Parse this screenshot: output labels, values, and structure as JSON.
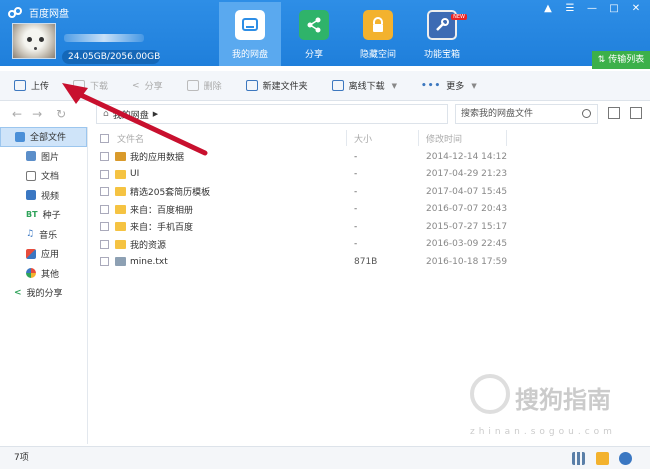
{
  "app": {
    "title": "百度网盘",
    "quota": "24.05GB/2056.00GB"
  },
  "nav": [
    {
      "label": "我的网盘"
    },
    {
      "label": "分享"
    },
    {
      "label": "隐藏空间"
    },
    {
      "label": "功能宝箱",
      "badge": "NEW"
    }
  ],
  "transfer_label": "传输列表",
  "toolbar": {
    "upload": "上传",
    "download": "下载",
    "share": "分享",
    "delete": "删除",
    "new_folder": "新建文件夹",
    "offline": "离线下载",
    "more": "更多"
  },
  "breadcrumb": {
    "root": "我的网盘"
  },
  "search": {
    "placeholder": "搜索我的网盘文件"
  },
  "sidebar": [
    {
      "label": "全部文件",
      "icon": "folder-icon"
    },
    {
      "label": "图片",
      "icon": "image-icon"
    },
    {
      "label": "文档",
      "icon": "document-icon"
    },
    {
      "label": "视频",
      "icon": "video-icon"
    },
    {
      "label": "种子",
      "icon": "bt-icon",
      "prefix": "BT"
    },
    {
      "label": "音乐",
      "icon": "music-icon"
    },
    {
      "label": "应用",
      "icon": "app-icon"
    },
    {
      "label": "其他",
      "icon": "other-icon"
    },
    {
      "label": "我的分享",
      "icon": "share-icon"
    }
  ],
  "columns": {
    "name": "文件名",
    "size": "大小",
    "modified": "修改时间"
  },
  "files": [
    {
      "name": "我的应用数据",
      "size": "-",
      "modified": "2014-12-14 14:12",
      "type": "apps"
    },
    {
      "name": "UI",
      "size": "-",
      "modified": "2017-04-29 21:23",
      "type": "folder"
    },
    {
      "name": "精选205套简历模板",
      "size": "-",
      "modified": "2017-04-07 15:45",
      "type": "folder"
    },
    {
      "name": "来自：百度相册",
      "size": "-",
      "modified": "2016-07-07 20:43",
      "type": "folder"
    },
    {
      "name": "来自：手机百度",
      "size": "-",
      "modified": "2015-07-27 15:17",
      "type": "folder"
    },
    {
      "name": "我的资源",
      "size": "-",
      "modified": "2016-03-09 22:45",
      "type": "folder"
    },
    {
      "name": "mine.txt",
      "size": "871B",
      "modified": "2016-10-18 17:59",
      "type": "txt"
    }
  ],
  "status": {
    "count": "7项"
  },
  "watermark": {
    "text": "搜狗指南",
    "url": "zhinan.sogou.com"
  },
  "colors": {
    "header": "#1f7fdb",
    "active_nav": "#5aa9ef",
    "transfer": "#3cb04a",
    "arrow": "#c8102e"
  }
}
